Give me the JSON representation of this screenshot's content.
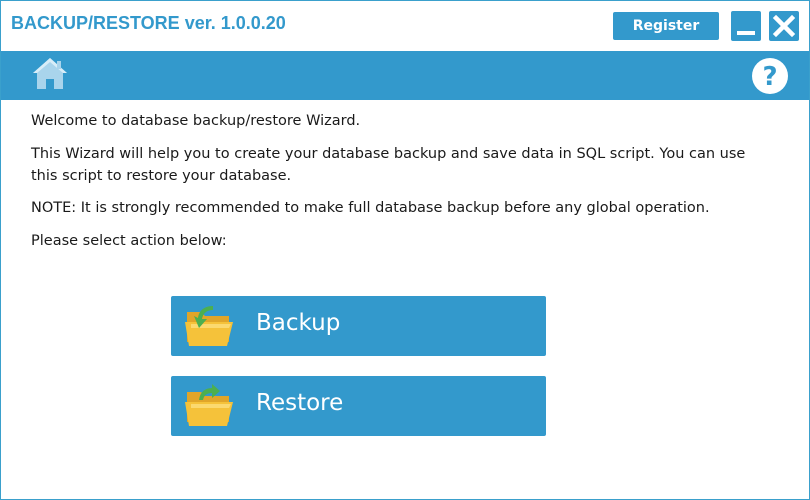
{
  "window": {
    "title": "BACKUP/RESTORE ver. 1.0.0.20",
    "register_label": "Register"
  },
  "colors": {
    "accent": "#3399cc",
    "text": "#1a1a1a",
    "background": "#ffffff",
    "folder": "#f5c23a",
    "arrow": "#4caf50"
  },
  "toolbar": {
    "left_icon": "home-icon",
    "right_icon": "help-icon"
  },
  "content": {
    "welcome": "Welcome to database backup/restore Wizard.",
    "description": "This Wizard will help you to create your database backup and save data in SQL script. You can use this script to restore your database.",
    "note": "NOTE: It is strongly recommended to make full database backup before any global operation.",
    "prompt": "Please select action below:"
  },
  "actions": [
    {
      "label": "Backup",
      "icon": "folder-backup-icon"
    },
    {
      "label": "Restore",
      "icon": "folder-restore-icon"
    }
  ]
}
